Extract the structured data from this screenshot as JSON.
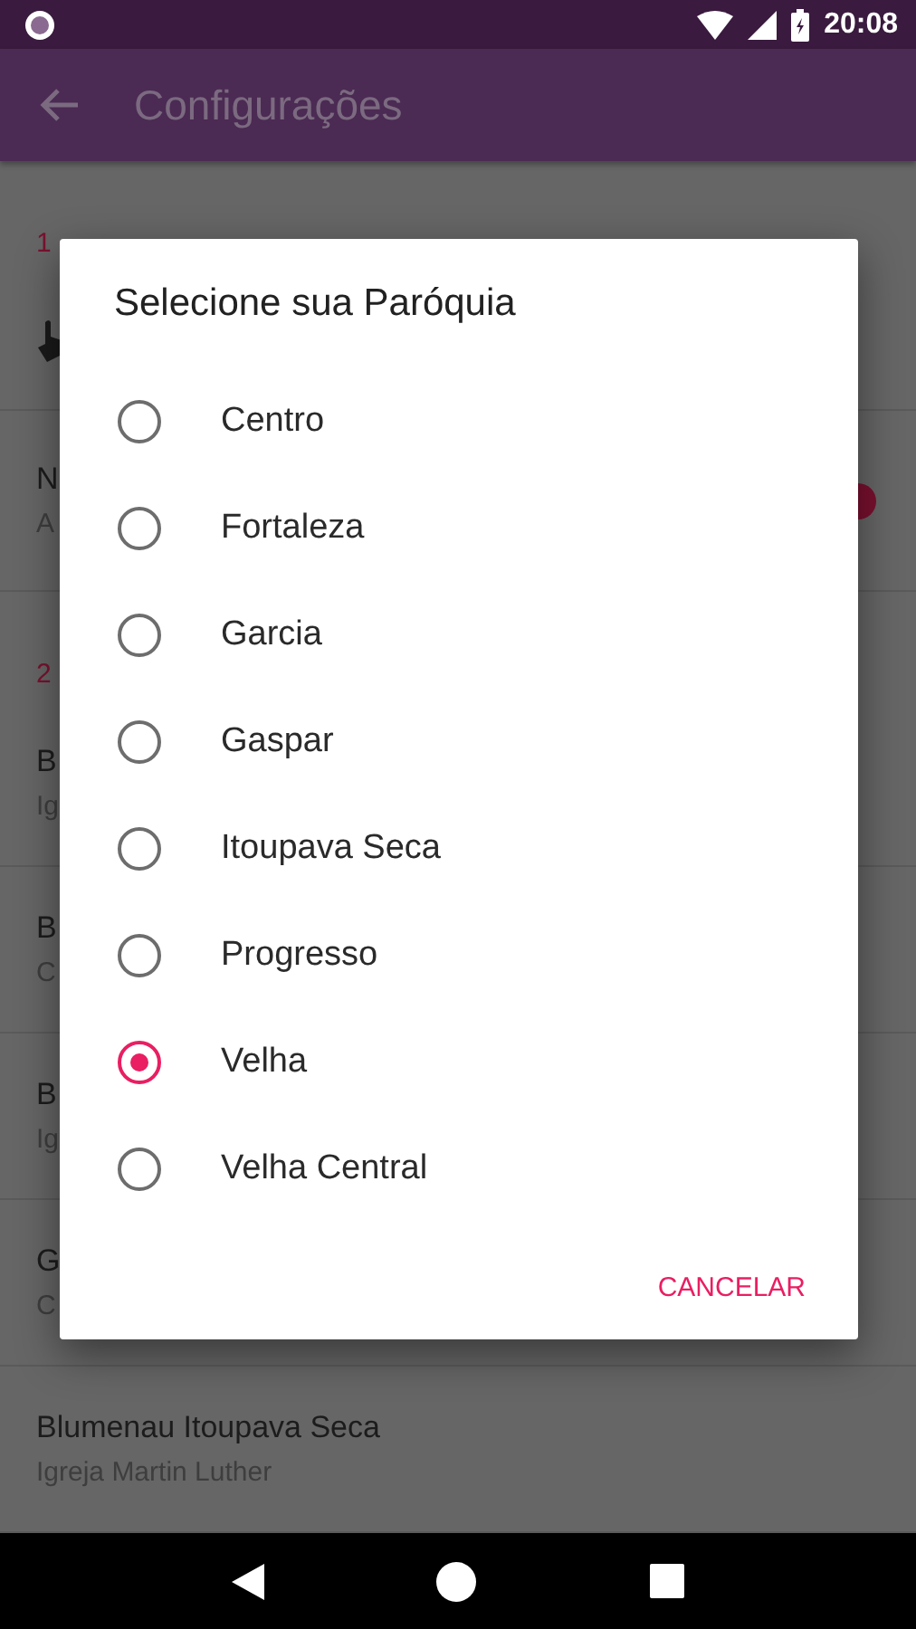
{
  "status_bar": {
    "time": "20:08"
  },
  "app_bar": {
    "title": "Configurações"
  },
  "background_list": [
    {
      "kind": "section",
      "label": "1"
    },
    {
      "kind": "gesture"
    },
    {
      "kind": "toggle",
      "title": "N",
      "subtitle": "A",
      "on": true
    },
    {
      "kind": "section",
      "label": "2"
    },
    {
      "kind": "row",
      "title": "B",
      "subtitle": "Ig"
    },
    {
      "kind": "row",
      "title": "B",
      "subtitle": "C"
    },
    {
      "kind": "row",
      "title": "B",
      "subtitle": "Ig"
    },
    {
      "kind": "row",
      "title": "G",
      "subtitle": "C"
    },
    {
      "kind": "row",
      "title": "Blumenau Itoupava Seca",
      "subtitle": "Igreja Martin Luther"
    }
  ],
  "dialog": {
    "title": "Selecione sua Paróquia",
    "options": [
      {
        "label": "Centro",
        "selected": false
      },
      {
        "label": "Fortaleza",
        "selected": false
      },
      {
        "label": "Garcia",
        "selected": false
      },
      {
        "label": "Gaspar",
        "selected": false
      },
      {
        "label": "Itoupava Seca",
        "selected": false
      },
      {
        "label": "Progresso",
        "selected": false
      },
      {
        "label": "Velha",
        "selected": true
      },
      {
        "label": "Velha Central",
        "selected": false
      }
    ],
    "button": "CANCELAR"
  }
}
